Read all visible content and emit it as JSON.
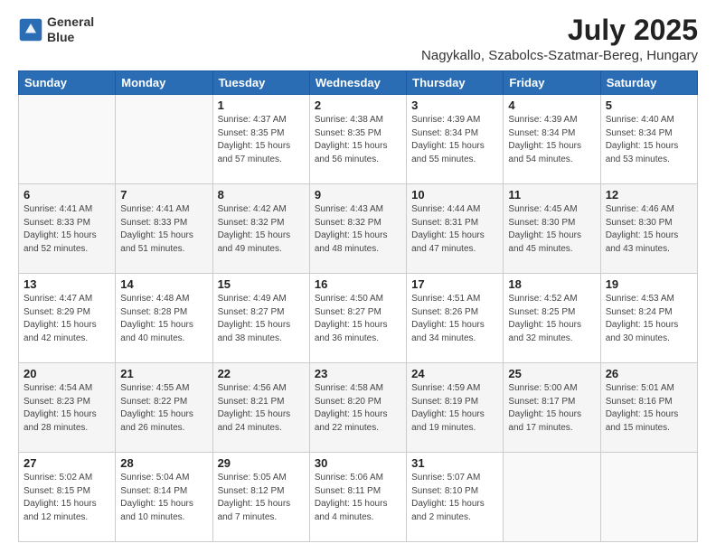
{
  "header": {
    "logo_line1": "General",
    "logo_line2": "Blue",
    "month": "July 2025",
    "location": "Nagykallo, Szabolcs-Szatmar-Bereg, Hungary"
  },
  "weekdays": [
    "Sunday",
    "Monday",
    "Tuesday",
    "Wednesday",
    "Thursday",
    "Friday",
    "Saturday"
  ],
  "weeks": [
    [
      {
        "day": "",
        "info": ""
      },
      {
        "day": "",
        "info": ""
      },
      {
        "day": "1",
        "info": "Sunrise: 4:37 AM\nSunset: 8:35 PM\nDaylight: 15 hours\nand 57 minutes."
      },
      {
        "day": "2",
        "info": "Sunrise: 4:38 AM\nSunset: 8:35 PM\nDaylight: 15 hours\nand 56 minutes."
      },
      {
        "day": "3",
        "info": "Sunrise: 4:39 AM\nSunset: 8:34 PM\nDaylight: 15 hours\nand 55 minutes."
      },
      {
        "day": "4",
        "info": "Sunrise: 4:39 AM\nSunset: 8:34 PM\nDaylight: 15 hours\nand 54 minutes."
      },
      {
        "day": "5",
        "info": "Sunrise: 4:40 AM\nSunset: 8:34 PM\nDaylight: 15 hours\nand 53 minutes."
      }
    ],
    [
      {
        "day": "6",
        "info": "Sunrise: 4:41 AM\nSunset: 8:33 PM\nDaylight: 15 hours\nand 52 minutes."
      },
      {
        "day": "7",
        "info": "Sunrise: 4:41 AM\nSunset: 8:33 PM\nDaylight: 15 hours\nand 51 minutes."
      },
      {
        "day": "8",
        "info": "Sunrise: 4:42 AM\nSunset: 8:32 PM\nDaylight: 15 hours\nand 49 minutes."
      },
      {
        "day": "9",
        "info": "Sunrise: 4:43 AM\nSunset: 8:32 PM\nDaylight: 15 hours\nand 48 minutes."
      },
      {
        "day": "10",
        "info": "Sunrise: 4:44 AM\nSunset: 8:31 PM\nDaylight: 15 hours\nand 47 minutes."
      },
      {
        "day": "11",
        "info": "Sunrise: 4:45 AM\nSunset: 8:30 PM\nDaylight: 15 hours\nand 45 minutes."
      },
      {
        "day": "12",
        "info": "Sunrise: 4:46 AM\nSunset: 8:30 PM\nDaylight: 15 hours\nand 43 minutes."
      }
    ],
    [
      {
        "day": "13",
        "info": "Sunrise: 4:47 AM\nSunset: 8:29 PM\nDaylight: 15 hours\nand 42 minutes."
      },
      {
        "day": "14",
        "info": "Sunrise: 4:48 AM\nSunset: 8:28 PM\nDaylight: 15 hours\nand 40 minutes."
      },
      {
        "day": "15",
        "info": "Sunrise: 4:49 AM\nSunset: 8:27 PM\nDaylight: 15 hours\nand 38 minutes."
      },
      {
        "day": "16",
        "info": "Sunrise: 4:50 AM\nSunset: 8:27 PM\nDaylight: 15 hours\nand 36 minutes."
      },
      {
        "day": "17",
        "info": "Sunrise: 4:51 AM\nSunset: 8:26 PM\nDaylight: 15 hours\nand 34 minutes."
      },
      {
        "day": "18",
        "info": "Sunrise: 4:52 AM\nSunset: 8:25 PM\nDaylight: 15 hours\nand 32 minutes."
      },
      {
        "day": "19",
        "info": "Sunrise: 4:53 AM\nSunset: 8:24 PM\nDaylight: 15 hours\nand 30 minutes."
      }
    ],
    [
      {
        "day": "20",
        "info": "Sunrise: 4:54 AM\nSunset: 8:23 PM\nDaylight: 15 hours\nand 28 minutes."
      },
      {
        "day": "21",
        "info": "Sunrise: 4:55 AM\nSunset: 8:22 PM\nDaylight: 15 hours\nand 26 minutes."
      },
      {
        "day": "22",
        "info": "Sunrise: 4:56 AM\nSunset: 8:21 PM\nDaylight: 15 hours\nand 24 minutes."
      },
      {
        "day": "23",
        "info": "Sunrise: 4:58 AM\nSunset: 8:20 PM\nDaylight: 15 hours\nand 22 minutes."
      },
      {
        "day": "24",
        "info": "Sunrise: 4:59 AM\nSunset: 8:19 PM\nDaylight: 15 hours\nand 19 minutes."
      },
      {
        "day": "25",
        "info": "Sunrise: 5:00 AM\nSunset: 8:17 PM\nDaylight: 15 hours\nand 17 minutes."
      },
      {
        "day": "26",
        "info": "Sunrise: 5:01 AM\nSunset: 8:16 PM\nDaylight: 15 hours\nand 15 minutes."
      }
    ],
    [
      {
        "day": "27",
        "info": "Sunrise: 5:02 AM\nSunset: 8:15 PM\nDaylight: 15 hours\nand 12 minutes."
      },
      {
        "day": "28",
        "info": "Sunrise: 5:04 AM\nSunset: 8:14 PM\nDaylight: 15 hours\nand 10 minutes."
      },
      {
        "day": "29",
        "info": "Sunrise: 5:05 AM\nSunset: 8:12 PM\nDaylight: 15 hours\nand 7 minutes."
      },
      {
        "day": "30",
        "info": "Sunrise: 5:06 AM\nSunset: 8:11 PM\nDaylight: 15 hours\nand 4 minutes."
      },
      {
        "day": "31",
        "info": "Sunrise: 5:07 AM\nSunset: 8:10 PM\nDaylight: 15 hours\nand 2 minutes."
      },
      {
        "day": "",
        "info": ""
      },
      {
        "day": "",
        "info": ""
      }
    ]
  ]
}
